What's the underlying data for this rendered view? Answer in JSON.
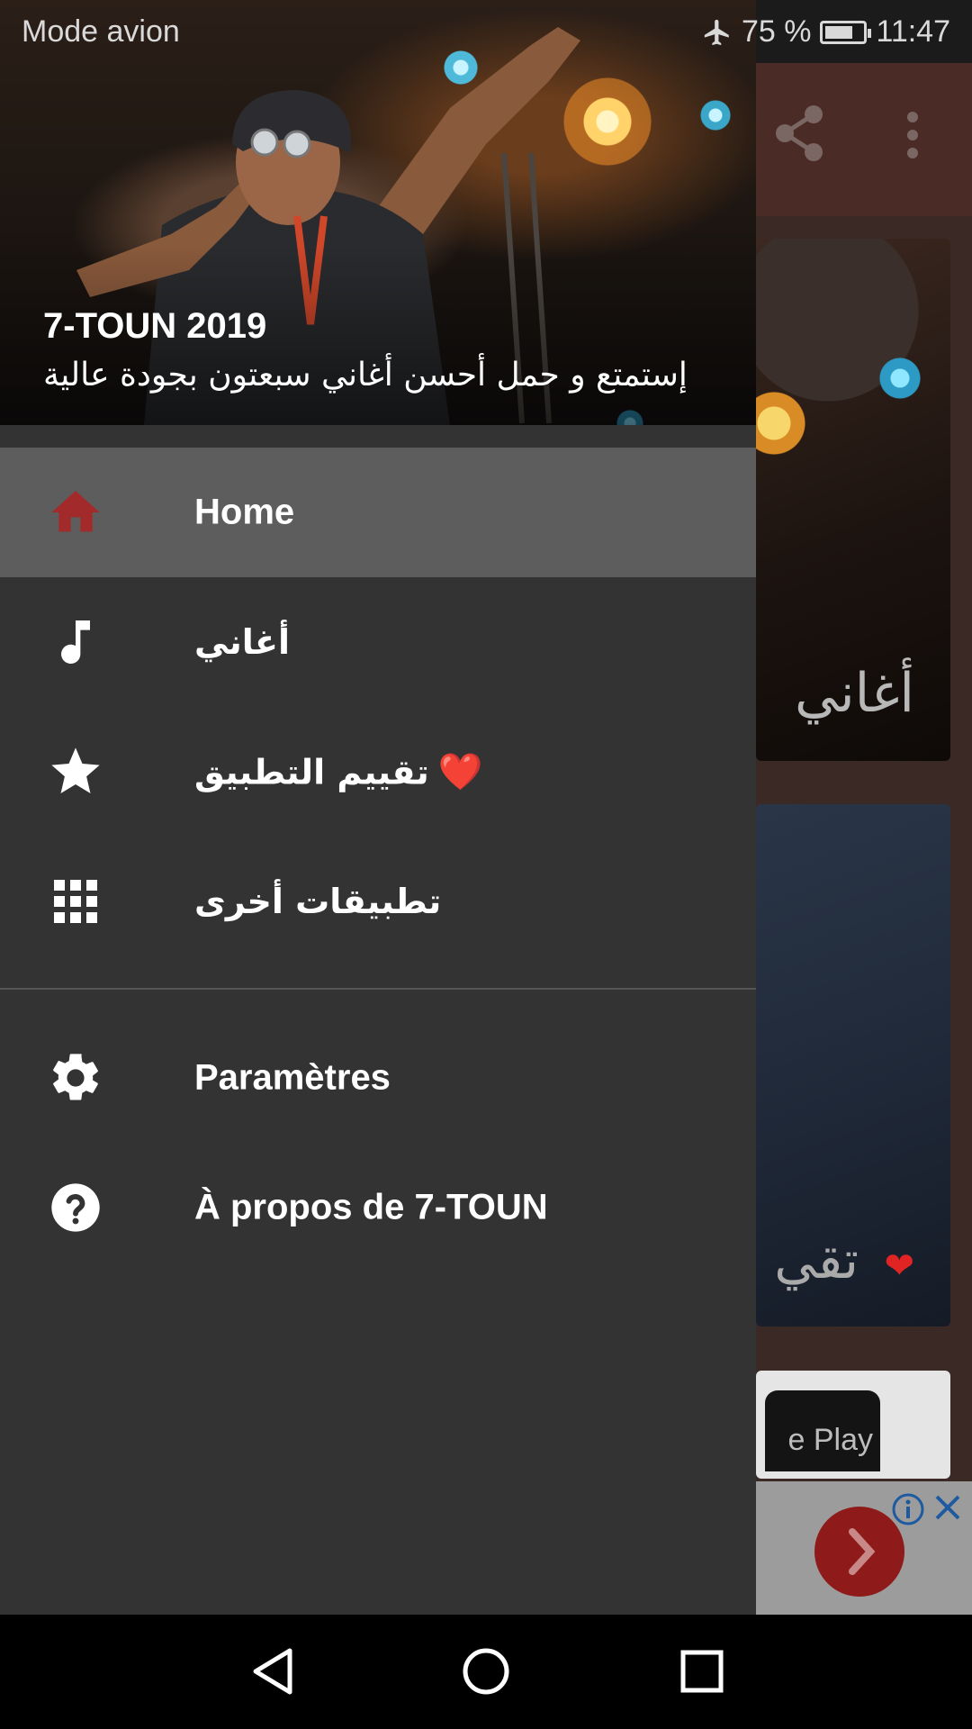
{
  "status_bar": {
    "left_text": "Mode avion",
    "battery_text": "75 %",
    "battery_level": 0.75,
    "time": "11:47",
    "icons": [
      "airplane-icon",
      "battery-icon"
    ]
  },
  "background_app": {
    "toolbar_icons": [
      "share-icon",
      "more-vert-icon"
    ],
    "card_1_title": "أغاني",
    "card_2_title": "تقي",
    "card_3_text": "e Play",
    "ad": {
      "icons": [
        "chevron-right-icon",
        "info-icon",
        "close-icon"
      ]
    }
  },
  "drawer": {
    "header": {
      "title": "7-TOUN 2019",
      "subtitle": "إستمتع و حمل أحسن أغاني سبعتون بجودة عالية"
    },
    "items": [
      {
        "label": "Home",
        "icon": "home-icon",
        "active": true
      },
      {
        "label": "أغاني",
        "icon": "music-note-icon",
        "active": false
      },
      {
        "label": "تقييم التطبيق",
        "suffix": "❤️",
        "icon": "star-icon",
        "active": false
      },
      {
        "label": "تطبيقات أخرى",
        "icon": "apps-grid-icon",
        "active": false
      }
    ],
    "secondary_items": [
      {
        "label": "Paramètres",
        "icon": "gear-icon"
      },
      {
        "label": "À propos de 7-TOUN",
        "icon": "help-icon"
      }
    ]
  },
  "nav_bar": {
    "buttons": [
      "back-icon",
      "home-circle-icon",
      "recents-icon"
    ]
  },
  "colors": {
    "drawer_bg": "#333333",
    "active_item_bg": "#5d5d5d",
    "home_icon": "#a32a2a",
    "accent_red": "#e02424"
  }
}
